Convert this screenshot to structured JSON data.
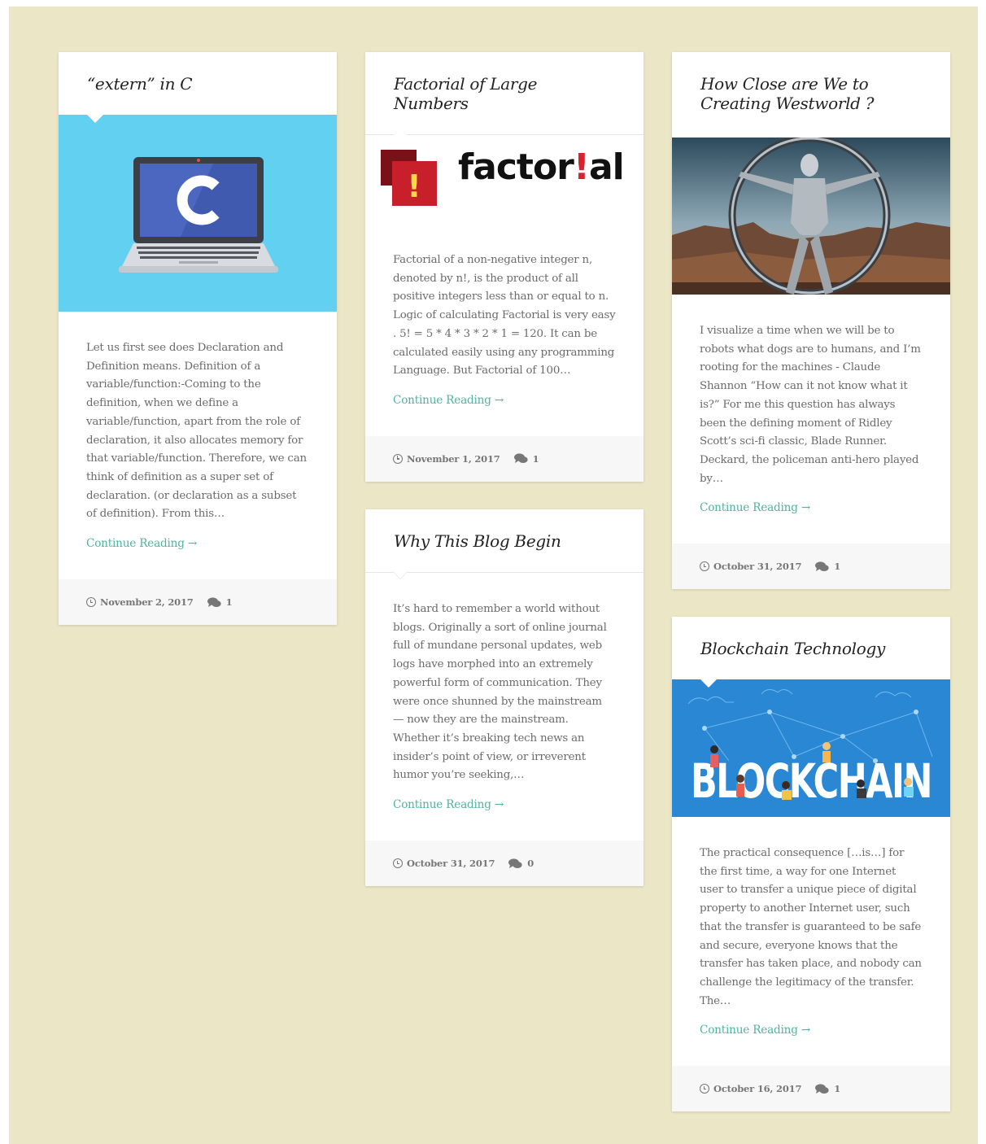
{
  "colors": {
    "background": "#ebe6c6",
    "accent_link": "#4fb3a0",
    "card": "#ffffff",
    "footer": "#f7f7f7"
  },
  "posts": [
    {
      "title": "“extern” in C",
      "excerpt": "Let us first see does Declaration and Definition means. Definition of a variable/function:-Coming to the definition, when we define a variable/function, apart from the role of declaration, it also allocates memory for that variable/function. Therefore, we can think of definition as a super set of declaration. (or declaration as a subset of definition). From this…",
      "read_more": "Continue Reading →",
      "date": "November 2, 2017",
      "comments": "1",
      "image_icon": "laptop-c-language-image"
    },
    {
      "title": "Factorial of Large Numbers",
      "logo_text_a": "factor",
      "logo_text_b": "!",
      "logo_text_c": "al",
      "logo_mark": "!",
      "excerpt": "Factorial of a non-negative integer n, denoted by n!, is the product of all positive integers less than or equal to n. Logic of calculating Factorial is very easy . 5! = 5 * 4 * 3 * 2 * 1 = 120. It can be calculated easily using any programming Language. But Factorial of 100…",
      "read_more": "Continue Reading →",
      "date": "November 1, 2017",
      "comments": "1"
    },
    {
      "title": "Why This Blog Begin",
      "excerpt": "It’s hard to remember a world without blogs. Originally a sort of online journal full of mundane personal updates, web logs have morphed into an extremely powerful form of communication. They were once shunned by the mainstream — now they are the mainstream. Whether it’s breaking tech news an insider’s point of view, or irreverent humor you’re seeking,…",
      "read_more": "Continue Reading →",
      "date": "October 31, 2017",
      "comments": "0"
    },
    {
      "title": "How Close are We to Creating Westworld ?",
      "excerpt": "I visualize a time when we will be to robots what dogs are to humans, and I’m rooting for the machines - Claude Shannon “How can it not know what it is?” For me this question has always been the defining moment of Ridley Scott’s sci-fi classic, Blade Runner. Deckard, the policeman anti-hero played by…",
      "read_more": "Continue Reading →",
      "date": "October 31, 2017",
      "comments": "1",
      "image_icon": "westworld-robot-image"
    },
    {
      "title": "Blockchain Technology",
      "banner_text": "BLOCKCHAIN",
      "excerpt": "The practical consequence […is…] for the first time, a way for one Internet user to transfer a unique piece of digital property to another Internet user, such that the transfer is guaranteed to be safe and secure, everyone knows that the transfer has taken place, and nobody can challenge the legitimacy of the transfer. The…",
      "read_more": "Continue Reading →",
      "date": "October 16, 2017",
      "comments": "1"
    }
  ]
}
